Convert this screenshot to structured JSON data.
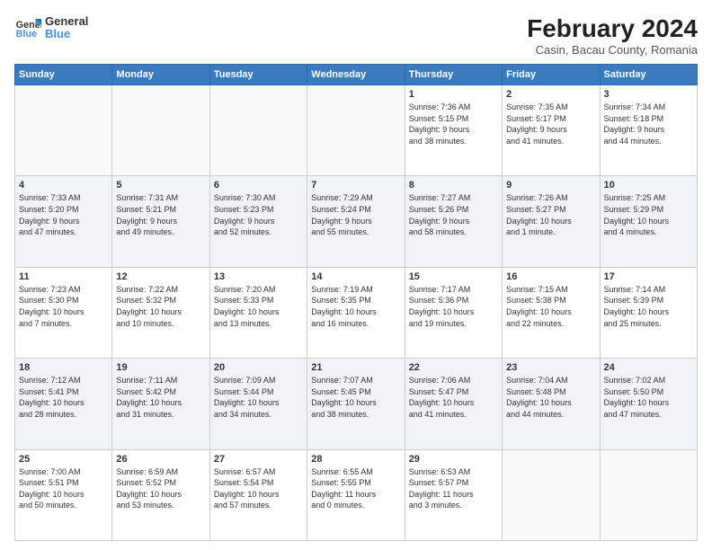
{
  "header": {
    "logo_line1": "General",
    "logo_line2": "Blue",
    "title": "February 2024",
    "subtitle": "Casin, Bacau County, Romania"
  },
  "days_of_week": [
    "Sunday",
    "Monday",
    "Tuesday",
    "Wednesday",
    "Thursday",
    "Friday",
    "Saturday"
  ],
  "weeks": [
    {
      "shade": "white",
      "days": [
        {
          "num": "",
          "info": ""
        },
        {
          "num": "",
          "info": ""
        },
        {
          "num": "",
          "info": ""
        },
        {
          "num": "",
          "info": ""
        },
        {
          "num": "1",
          "info": "Sunrise: 7:36 AM\nSunset: 5:15 PM\nDaylight: 9 hours\nand 38 minutes."
        },
        {
          "num": "2",
          "info": "Sunrise: 7:35 AM\nSunset: 5:17 PM\nDaylight: 9 hours\nand 41 minutes."
        },
        {
          "num": "3",
          "info": "Sunrise: 7:34 AM\nSunset: 5:18 PM\nDaylight: 9 hours\nand 44 minutes."
        }
      ]
    },
    {
      "shade": "shade",
      "days": [
        {
          "num": "4",
          "info": "Sunrise: 7:33 AM\nSunset: 5:20 PM\nDaylight: 9 hours\nand 47 minutes."
        },
        {
          "num": "5",
          "info": "Sunrise: 7:31 AM\nSunset: 5:21 PM\nDaylight: 9 hours\nand 49 minutes."
        },
        {
          "num": "6",
          "info": "Sunrise: 7:30 AM\nSunset: 5:23 PM\nDaylight: 9 hours\nand 52 minutes."
        },
        {
          "num": "7",
          "info": "Sunrise: 7:29 AM\nSunset: 5:24 PM\nDaylight: 9 hours\nand 55 minutes."
        },
        {
          "num": "8",
          "info": "Sunrise: 7:27 AM\nSunset: 5:26 PM\nDaylight: 9 hours\nand 58 minutes."
        },
        {
          "num": "9",
          "info": "Sunrise: 7:26 AM\nSunset: 5:27 PM\nDaylight: 10 hours\nand 1 minute."
        },
        {
          "num": "10",
          "info": "Sunrise: 7:25 AM\nSunset: 5:29 PM\nDaylight: 10 hours\nand 4 minutes."
        }
      ]
    },
    {
      "shade": "white",
      "days": [
        {
          "num": "11",
          "info": "Sunrise: 7:23 AM\nSunset: 5:30 PM\nDaylight: 10 hours\nand 7 minutes."
        },
        {
          "num": "12",
          "info": "Sunrise: 7:22 AM\nSunset: 5:32 PM\nDaylight: 10 hours\nand 10 minutes."
        },
        {
          "num": "13",
          "info": "Sunrise: 7:20 AM\nSunset: 5:33 PM\nDaylight: 10 hours\nand 13 minutes."
        },
        {
          "num": "14",
          "info": "Sunrise: 7:19 AM\nSunset: 5:35 PM\nDaylight: 10 hours\nand 16 minutes."
        },
        {
          "num": "15",
          "info": "Sunrise: 7:17 AM\nSunset: 5:36 PM\nDaylight: 10 hours\nand 19 minutes."
        },
        {
          "num": "16",
          "info": "Sunrise: 7:15 AM\nSunset: 5:38 PM\nDaylight: 10 hours\nand 22 minutes."
        },
        {
          "num": "17",
          "info": "Sunrise: 7:14 AM\nSunset: 5:39 PM\nDaylight: 10 hours\nand 25 minutes."
        }
      ]
    },
    {
      "shade": "shade",
      "days": [
        {
          "num": "18",
          "info": "Sunrise: 7:12 AM\nSunset: 5:41 PM\nDaylight: 10 hours\nand 28 minutes."
        },
        {
          "num": "19",
          "info": "Sunrise: 7:11 AM\nSunset: 5:42 PM\nDaylight: 10 hours\nand 31 minutes."
        },
        {
          "num": "20",
          "info": "Sunrise: 7:09 AM\nSunset: 5:44 PM\nDaylight: 10 hours\nand 34 minutes."
        },
        {
          "num": "21",
          "info": "Sunrise: 7:07 AM\nSunset: 5:45 PM\nDaylight: 10 hours\nand 38 minutes."
        },
        {
          "num": "22",
          "info": "Sunrise: 7:06 AM\nSunset: 5:47 PM\nDaylight: 10 hours\nand 41 minutes."
        },
        {
          "num": "23",
          "info": "Sunrise: 7:04 AM\nSunset: 5:48 PM\nDaylight: 10 hours\nand 44 minutes."
        },
        {
          "num": "24",
          "info": "Sunrise: 7:02 AM\nSunset: 5:50 PM\nDaylight: 10 hours\nand 47 minutes."
        }
      ]
    },
    {
      "shade": "white",
      "days": [
        {
          "num": "25",
          "info": "Sunrise: 7:00 AM\nSunset: 5:51 PM\nDaylight: 10 hours\nand 50 minutes."
        },
        {
          "num": "26",
          "info": "Sunrise: 6:59 AM\nSunset: 5:52 PM\nDaylight: 10 hours\nand 53 minutes."
        },
        {
          "num": "27",
          "info": "Sunrise: 6:57 AM\nSunset: 5:54 PM\nDaylight: 10 hours\nand 57 minutes."
        },
        {
          "num": "28",
          "info": "Sunrise: 6:55 AM\nSunset: 5:55 PM\nDaylight: 11 hours\nand 0 minutes."
        },
        {
          "num": "29",
          "info": "Sunrise: 6:53 AM\nSunset: 5:57 PM\nDaylight: 11 hours\nand 3 minutes."
        },
        {
          "num": "",
          "info": ""
        },
        {
          "num": "",
          "info": ""
        }
      ]
    }
  ]
}
